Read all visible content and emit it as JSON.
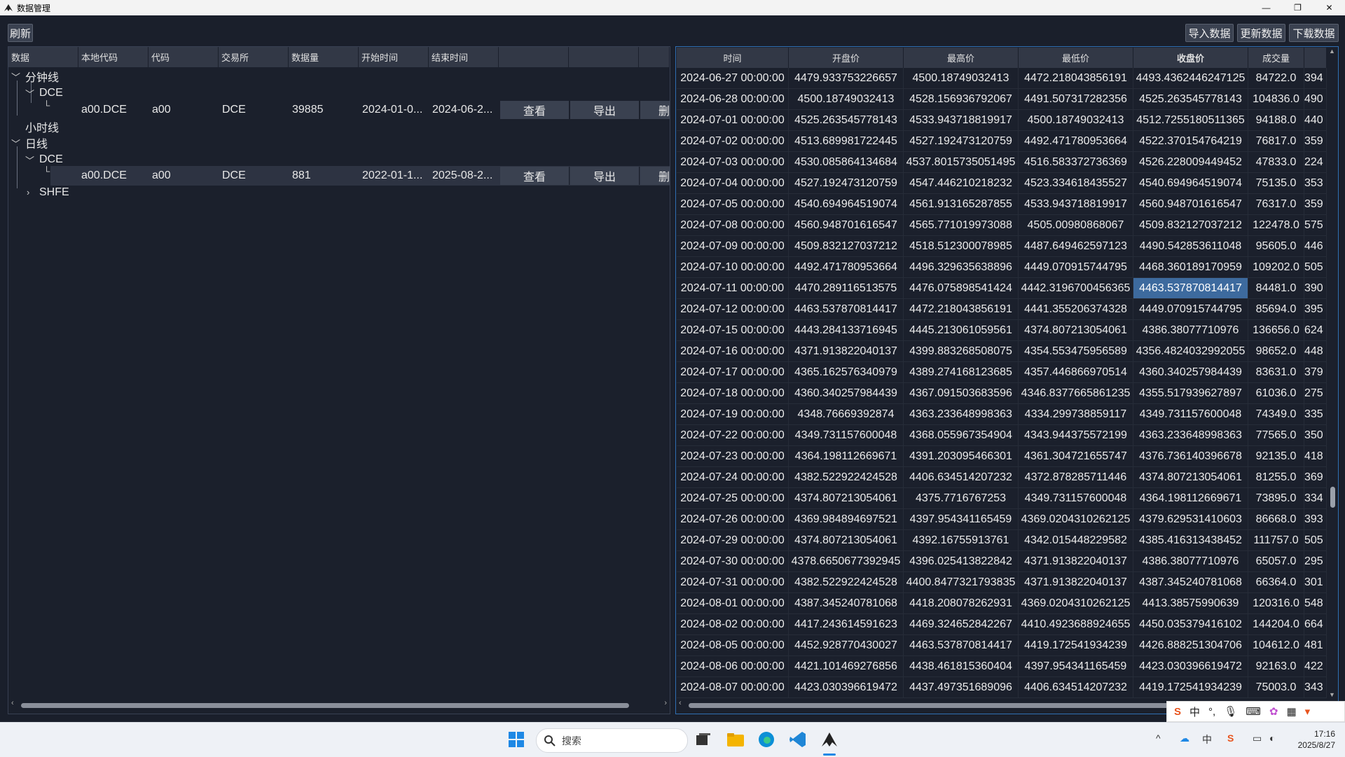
{
  "window": {
    "title": "数据管理",
    "minimize": "—",
    "restore": "❐",
    "close": "✕"
  },
  "toolbar": {
    "refresh": "刷新",
    "import": "导入数据",
    "update": "更新数据",
    "download": "下载数据"
  },
  "left": {
    "headers": [
      "数据",
      "本地代码",
      "代码",
      "交易所",
      "数据量",
      "开始时间",
      "结束时间",
      "",
      "",
      ""
    ],
    "tree": {
      "minute": "分钟线",
      "hour": "小时线",
      "day": "日线",
      "dce": "DCE",
      "shfe": "SHFE"
    },
    "rows": [
      {
        "local_code": "a00.DCE",
        "code": "a00",
        "exchange": "DCE",
        "count": "39885",
        "start": "2024-01-0...",
        "end": "2024-06-2...",
        "view": "查看",
        "export": "导出",
        "del": "删"
      },
      {
        "local_code": "a00.DCE",
        "code": "a00",
        "exchange": "DCE",
        "count": "881",
        "start": "2022-01-1...",
        "end": "2025-08-2...",
        "view": "查看",
        "export": "导出",
        "del": "删"
      }
    ]
  },
  "right": {
    "headers": [
      "时间",
      "开盘价",
      "最高价",
      "最低价",
      "收盘价",
      "成交量",
      ""
    ],
    "rows": [
      [
        "2024-06-27 00:00:00",
        "4479.933753226657",
        "4500.18749032413",
        "4472.218043856191",
        "4493.4362446247125",
        "84722.0",
        "394"
      ],
      [
        "2024-06-28 00:00:00",
        "4500.18749032413",
        "4528.156936792067",
        "4491.507317282356",
        "4525.263545778143",
        "104836.0",
        "490"
      ],
      [
        "2024-07-01 00:00:00",
        "4525.263545778143",
        "4533.943718819917",
        "4500.18749032413",
        "4512.7255180511365",
        "94188.0",
        "440"
      ],
      [
        "2024-07-02 00:00:00",
        "4513.689981722445",
        "4527.192473120759",
        "4492.471780953664",
        "4522.370154764219",
        "76817.0",
        "359"
      ],
      [
        "2024-07-03 00:00:00",
        "4530.085864134684",
        "4537.8015735051495",
        "4516.583372736369",
        "4526.228009449452",
        "47833.0",
        "224"
      ],
      [
        "2024-07-04 00:00:00",
        "4527.192473120759",
        "4547.446210218232",
        "4523.334618435527",
        "4540.694964519074",
        "75135.0",
        "353"
      ],
      [
        "2024-07-05 00:00:00",
        "4540.694964519074",
        "4561.913165287855",
        "4533.943718819917",
        "4560.948701616547",
        "76317.0",
        "359"
      ],
      [
        "2024-07-08 00:00:00",
        "4560.948701616547",
        "4565.771019973088",
        "4505.00980868067",
        "4509.832127037212",
        "122478.0",
        "575"
      ],
      [
        "2024-07-09 00:00:00",
        "4509.832127037212",
        "4518.512300078985",
        "4487.649462597123",
        "4490.542853611048",
        "95605.0",
        "446"
      ],
      [
        "2024-07-10 00:00:00",
        "4492.471780953664",
        "4496.329635638896",
        "4449.070915744795",
        "4468.360189170959",
        "109202.0",
        "505"
      ],
      [
        "2024-07-11 00:00:00",
        "4470.289116513575",
        "4476.075898541424",
        "4442.3196700456365",
        "4463.537870814417",
        "84481.0",
        "390"
      ],
      [
        "2024-07-12 00:00:00",
        "4463.537870814417",
        "4472.218043856191",
        "4441.355206374328",
        "4449.070915744795",
        "85694.0",
        "395"
      ],
      [
        "2024-07-15 00:00:00",
        "4443.284133716945",
        "4445.213061059561",
        "4374.807213054061",
        "4386.38077710976",
        "136656.0",
        "624"
      ],
      [
        "2024-07-16 00:00:00",
        "4371.913822040137",
        "4399.883268508075",
        "4354.553475956589",
        "4356.4824032992055",
        "98652.0",
        "448"
      ],
      [
        "2024-07-17 00:00:00",
        "4365.162576340979",
        "4389.274168123685",
        "4357.446866970514",
        "4360.340257984439",
        "83631.0",
        "379"
      ],
      [
        "2024-07-18 00:00:00",
        "4360.340257984439",
        "4367.091503683596",
        "4346.8377665861235",
        "4355.517939627897",
        "61036.0",
        "275"
      ],
      [
        "2024-07-19 00:00:00",
        "4348.76669392874",
        "4363.233648998363",
        "4334.299738859117",
        "4349.731157600048",
        "74349.0",
        "335"
      ],
      [
        "2024-07-22 00:00:00",
        "4349.731157600048",
        "4368.055967354904",
        "4343.944375572199",
        "4363.233648998363",
        "77565.0",
        "350"
      ],
      [
        "2024-07-23 00:00:00",
        "4364.198112669671",
        "4391.203095466301",
        "4361.304721655747",
        "4376.736140396678",
        "92135.0",
        "418"
      ],
      [
        "2024-07-24 00:00:00",
        "4382.522922424528",
        "4406.634514207232",
        "4372.878285711446",
        "4374.807213054061",
        "81255.0",
        "369"
      ],
      [
        "2024-07-25 00:00:00",
        "4374.807213054061",
        "4375.7716767253",
        "4349.731157600048",
        "4364.198112669671",
        "73895.0",
        "334"
      ],
      [
        "2024-07-26 00:00:00",
        "4369.984894697521",
        "4397.954341165459",
        "4369.0204310262125",
        "4379.629531410603",
        "86668.0",
        "393"
      ],
      [
        "2024-07-29 00:00:00",
        "4374.807213054061",
        "4392.16755913761",
        "4342.015448229582",
        "4385.416313438452",
        "111757.0",
        "505"
      ],
      [
        "2024-07-30 00:00:00",
        "4378.6650677392945",
        "4396.025413822842",
        "4371.913822040137",
        "4386.38077710976",
        "65057.0",
        "295"
      ],
      [
        "2024-07-31 00:00:00",
        "4382.522922424528",
        "4400.8477321793835",
        "4371.913822040137",
        "4387.345240781068",
        "66364.0",
        "301"
      ],
      [
        "2024-08-01 00:00:00",
        "4387.345240781068",
        "4418.208078262931",
        "4369.0204310262125",
        "4413.38575990639",
        "120316.0",
        "548"
      ],
      [
        "2024-08-02 00:00:00",
        "4417.243614591623",
        "4469.324652842267",
        "4410.4923688924655",
        "4450.035379416102",
        "144204.0",
        "664"
      ],
      [
        "2024-08-05 00:00:00",
        "4452.928770430027",
        "4463.537870814417",
        "4419.172541934239",
        "4426.888251304706",
        "104612.0",
        "481"
      ],
      [
        "2024-08-06 00:00:00",
        "4421.101469276856",
        "4438.461815360404",
        "4397.954341165459",
        "4423.030396619472",
        "92163.0",
        "422"
      ],
      [
        "2024-08-07 00:00:00",
        "4423.030396619472",
        "4437.497351689096",
        "4406.634514207232",
        "4419.172541934239",
        "75003.0",
        "343"
      ]
    ],
    "highlight": {
      "row": 10,
      "col": 4
    }
  },
  "ime": {
    "logo": "S",
    "lang": "中",
    "punct": "°,",
    "mic": "🎙",
    "keyboard": "⌨",
    "skin": "✿",
    "grid": "▦",
    "tool": "▾"
  },
  "taskbar": {
    "search_placeholder": "搜索",
    "time": "17:16",
    "date": "2025/8/27",
    "tray_up": "^",
    "tray_lang": "中"
  }
}
